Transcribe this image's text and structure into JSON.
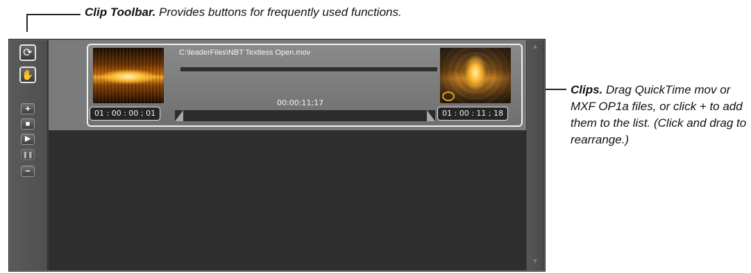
{
  "annotations": {
    "toolbar_title": "Clip Toolbar.",
    "toolbar_desc": " Provides buttons for frequently used functions.",
    "clips_title": "Clips.",
    "clips_desc": " Drag QuickTime mov or MXF OP1a files, or click + to add them to the list. (Click and drag to rearrange.)"
  },
  "toolbar": {
    "buttons": [
      {
        "name": "loop",
        "icon": "loop-icon",
        "glyph": "⟳"
      },
      {
        "name": "hand",
        "icon": "hand-icon",
        "glyph": "✋"
      },
      {
        "name": "add",
        "icon": "plus-icon",
        "glyph": "+"
      },
      {
        "name": "stop",
        "icon": "stop-icon",
        "glyph": "■"
      },
      {
        "name": "play",
        "icon": "play-icon",
        "glyph": "▶"
      },
      {
        "name": "pause",
        "icon": "pause-icon",
        "glyph": "❚❚",
        "disabled": true
      },
      {
        "name": "remove",
        "icon": "minus-icon",
        "glyph": "−"
      }
    ]
  },
  "clips": [
    {
      "path": "C:\\leaderFiles\\NBT Textless Open.mov",
      "duration": "00:00:11;17",
      "tc_in": "01 : 00 : 00 ; 01",
      "tc_out": "01 : 00 : 11 ; 18"
    }
  ],
  "scrollbar": {
    "up_glyph": "▲",
    "down_glyph": "▼"
  },
  "colors": {
    "panel": "#3c3c3c",
    "clip_row": "#7b7b7b",
    "selection_border": "#f2f2f2",
    "thumbnail_accent": "#ffb02a"
  }
}
